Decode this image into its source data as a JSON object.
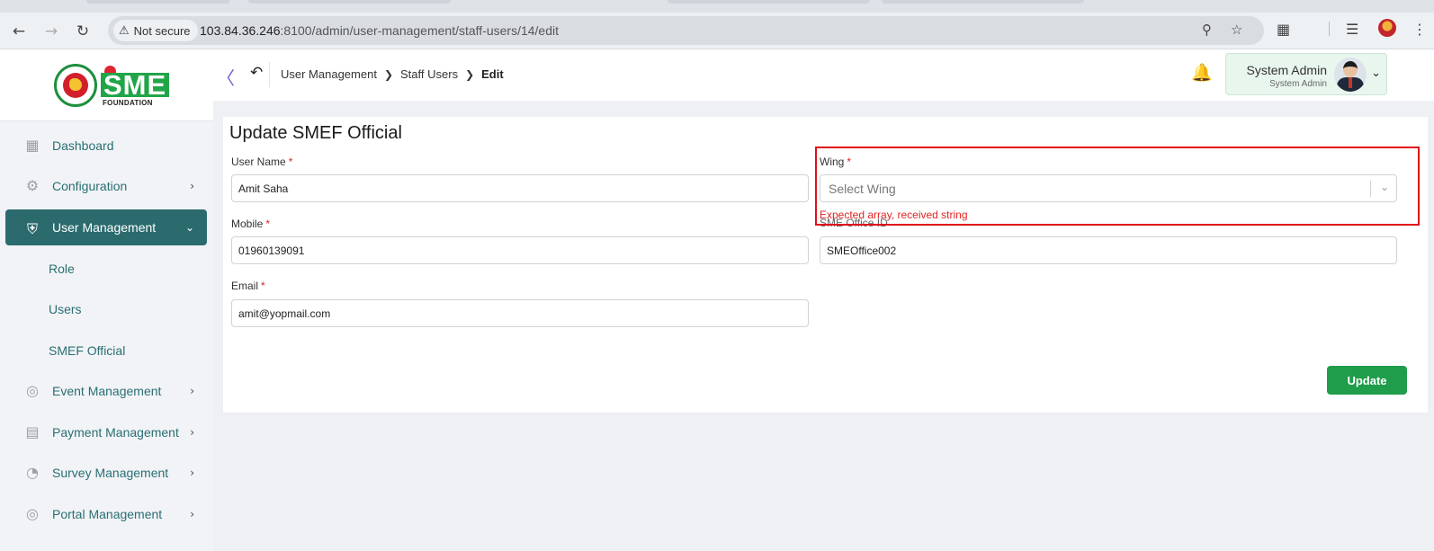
{
  "browser": {
    "security_label": "Not secure",
    "url_host": "103.84.36.246",
    "url_rest": ":8100/admin/user-management/staff-users/14/edit"
  },
  "logo": {
    "brand": "SME",
    "subtitle": "FOUNDATION"
  },
  "sidebar": {
    "items": [
      {
        "label": "Dashboard",
        "icon": "dashboard-icon",
        "has_chevron": false
      },
      {
        "label": "Configuration",
        "icon": "configuration-icon",
        "has_chevron": true
      },
      {
        "label": "User Management",
        "icon": "shield-user-icon",
        "has_chevron": true,
        "active": true
      },
      {
        "label": "Role",
        "sub": true
      },
      {
        "label": "Users",
        "sub": true
      },
      {
        "label": "SMEF Official",
        "sub": true
      },
      {
        "label": "Event Management",
        "icon": "event-icon",
        "has_chevron": true
      },
      {
        "label": "Payment Management",
        "icon": "payment-icon",
        "has_chevron": true
      },
      {
        "label": "Survey Management",
        "icon": "survey-icon",
        "has_chevron": true
      },
      {
        "label": "Portal Management",
        "icon": "portal-icon",
        "has_chevron": true
      }
    ]
  },
  "breadcrumb": [
    "User Management",
    "Staff Users",
    "Edit"
  ],
  "user": {
    "name": "System Admin",
    "role": "System Admin"
  },
  "form": {
    "title": "Update SMEF Official",
    "username_label": "User Name",
    "username_value": "Amit Saha",
    "wing_label": "Wing",
    "wing_placeholder": "Select Wing",
    "wing_error": "Expected array, received string",
    "mobile_label": "Mobile",
    "mobile_value": "01960139091",
    "office_label": "SME Office ID",
    "office_value": "SMEOffice002",
    "email_label": "Email",
    "email_value": "amit@yopmail.com",
    "submit_label": "Update"
  },
  "colors": {
    "accent": "#2b6b6e",
    "submit": "#1f9d4a",
    "error": "#e02424",
    "highlight": "#e0101a"
  }
}
